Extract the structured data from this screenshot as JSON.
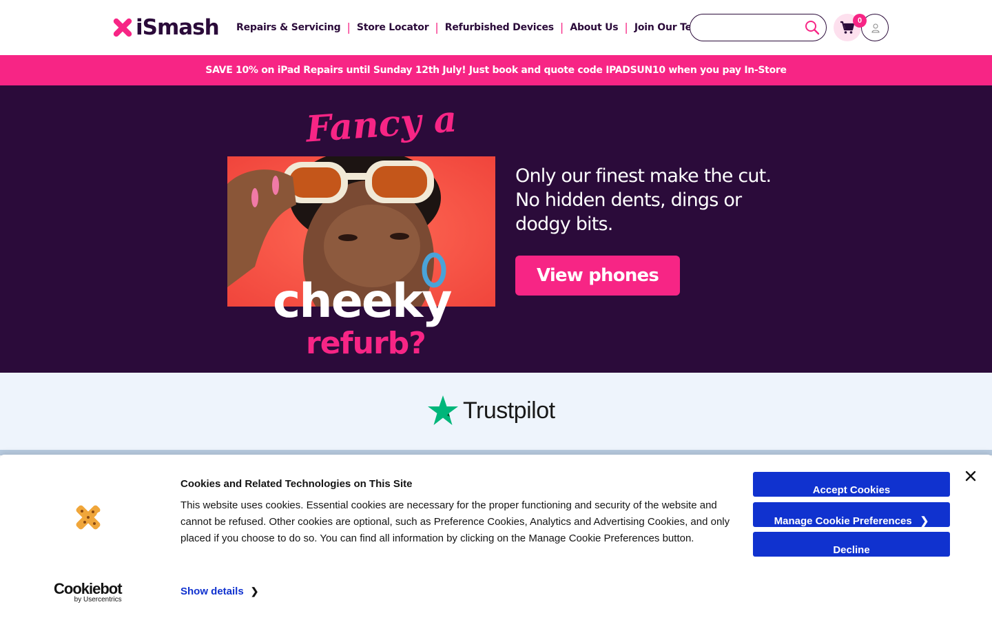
{
  "header": {
    "logo_text": "iSmash",
    "nav": [
      {
        "label": "Repairs & Servicing"
      },
      {
        "label": "Store Locator"
      },
      {
        "label": "Refurbished Devices"
      },
      {
        "label": "About Us"
      },
      {
        "label": "Join Our Team"
      }
    ],
    "search": {
      "placeholder": "",
      "value": ""
    },
    "cart_count": "0"
  },
  "promo": {
    "text": "SAVE 10% on iPad Repairs until Sunday 12th July! Just book and quote code IPADSUN10 when you pay In-Store"
  },
  "hero": {
    "fancy": "Fancy a",
    "cheeky": "cheeky",
    "refurb": "refurb?",
    "copy": "Only our finest make the cut. No hidden dents, dings or dodgy bits.",
    "cta": "View phones"
  },
  "trust": {
    "name": "Trustpilot"
  },
  "cookie": {
    "title": "Cookies and Related Technologies on This Site",
    "body": "This website uses cookies. Essential cookies are necessary for the proper functioning and security of the website and cannot be refused. Other cookies are optional, such as Preference Cookies, Analytics and Advertising Cookies, and only placed if you choose to do so. You can find all information by clicking on the Manage Cookie Preferences button.",
    "show_details": "Show details",
    "accept": "Accept Cookies",
    "manage": "Manage Cookie Preferences",
    "decline": "Decline",
    "brand_name": "Cookiebot",
    "brand_by": "by Usercentrics"
  },
  "colors": {
    "brand_pink": "#f72585",
    "brand_purple": "#2b0b3a",
    "cookie_blue": "#1032cf",
    "trust_green": "#00b67a"
  }
}
